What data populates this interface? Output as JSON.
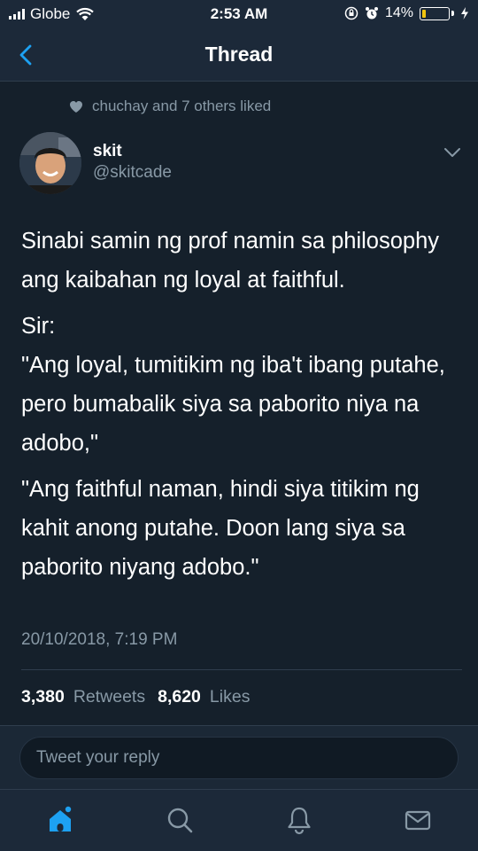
{
  "status_bar": {
    "carrier": "Globe",
    "time": "2:53 AM",
    "battery_percent": "14%",
    "battery_level": 0.14
  },
  "nav": {
    "title": "Thread"
  },
  "social_context": {
    "text": "chuchay and 7 others liked"
  },
  "tweet": {
    "author_name": "skit",
    "author_handle": "@skitcade",
    "paragraphs": [
      "Sinabi samin ng prof namin sa philosophy ang kaibahan ng loyal at faithful.",
      "Sir:",
      "\"Ang loyal, tumitikim ng iba't ibang putahe, pero bumabalik siya sa paborito niya na adobo,\"",
      "\"Ang faithful naman, hindi siya titikim ng kahit anong putahe. Doon lang siya sa paborito niyang adobo.\""
    ],
    "timestamp": "20/10/2018, 7:19 PM",
    "retweets_count": "3,380",
    "retweets_label": "Retweets",
    "likes_count": "8,620",
    "likes_label": "Likes"
  },
  "reply": {
    "placeholder": "Tweet your reply"
  },
  "tabs": [
    {
      "name": "home",
      "icon": "home-icon",
      "active": true
    },
    {
      "name": "search",
      "icon": "search-icon",
      "active": false
    },
    {
      "name": "notifications",
      "icon": "bell-icon",
      "active": false
    },
    {
      "name": "messages",
      "icon": "mail-icon",
      "active": false
    }
  ],
  "colors": {
    "accent": "#1da1f2",
    "background": "#15202b",
    "bar_background": "#1c2939",
    "secondary_text": "#8899a6",
    "battery_low": "#f1c40f"
  }
}
